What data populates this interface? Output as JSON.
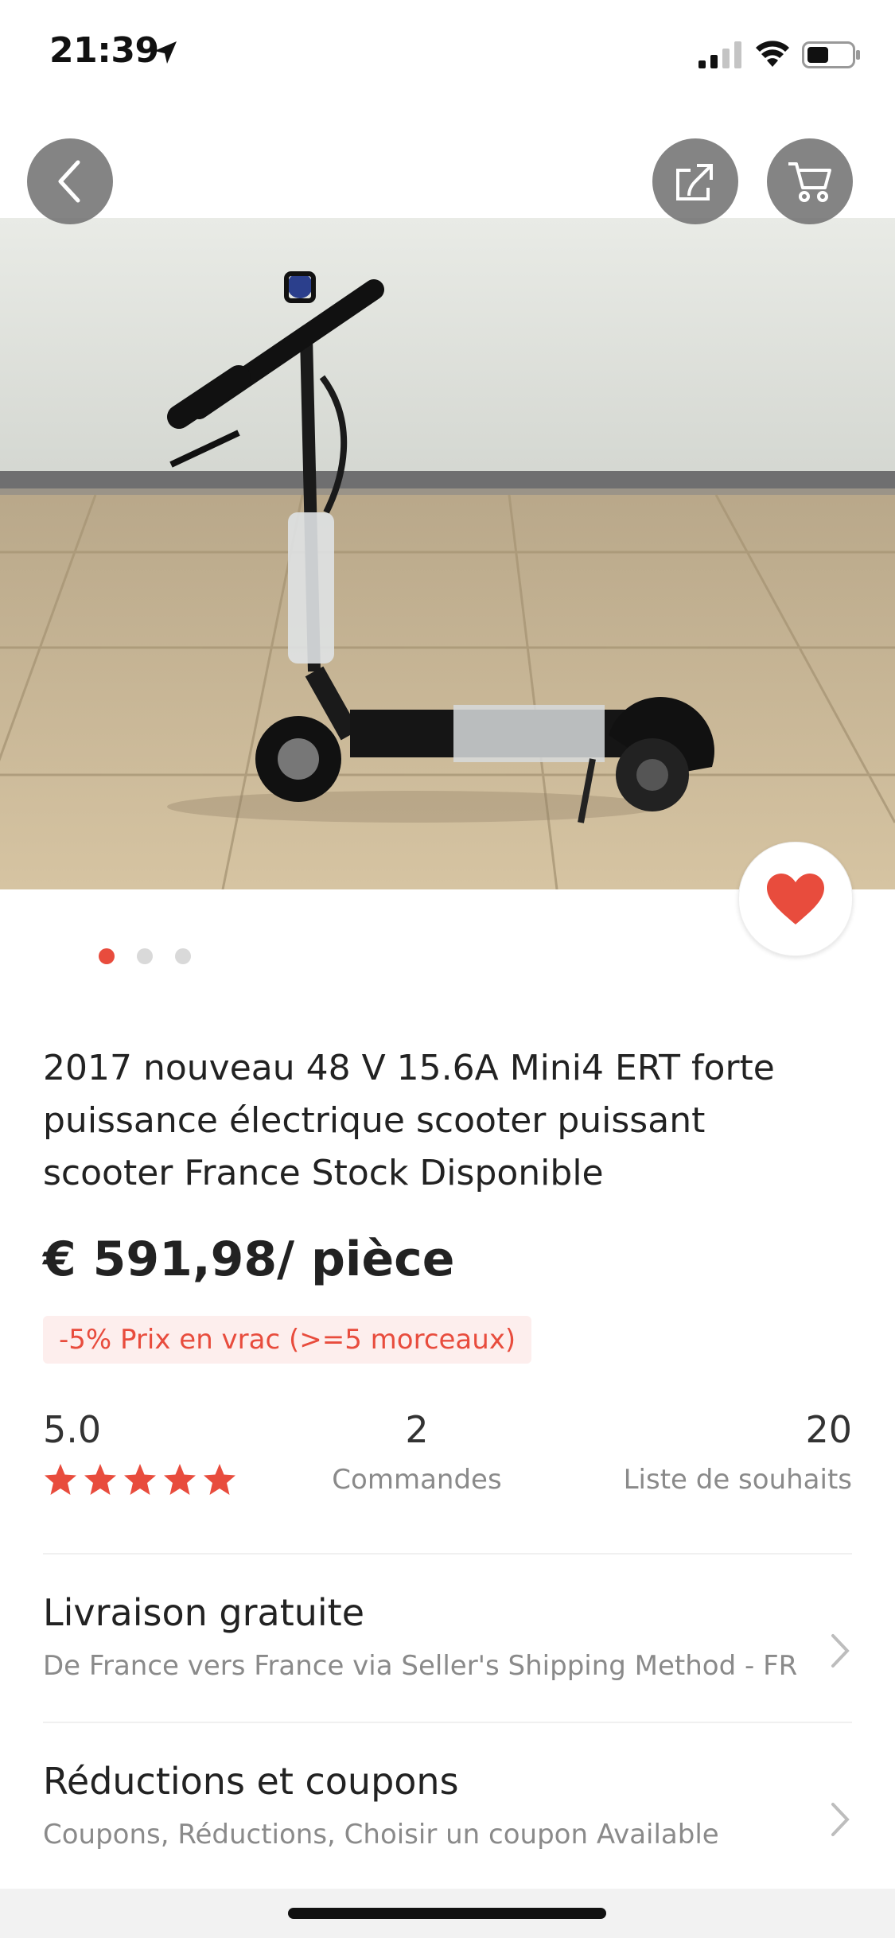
{
  "status_bar": {
    "time": "21:39"
  },
  "product": {
    "title": "2017 nouveau 48 V 15.6A Mini4 ERT forte puissance électrique scooter puissant scooter France Stock Disponible",
    "price": "€ 591,98/ pièce",
    "bulk_discount": "-5% Prix en vrac (>=5 morceaux)"
  },
  "carousel": {
    "total": 3,
    "active": 1
  },
  "stats": {
    "rating": "5.0",
    "stars": 5,
    "orders_count": "2",
    "orders_label": "Commandes",
    "wishlist_count": "20",
    "wishlist_label": "Liste de souhaits"
  },
  "shipping": {
    "title": "Livraison gratuite",
    "subtitle": "De France vers France via Seller's Shipping Method - FR"
  },
  "coupons": {
    "title": "Réductions et coupons",
    "subtitle": "Coupons, Réductions, Choisir un coupon Available"
  },
  "colors": {
    "accent": "#e84c3d"
  },
  "icons": [
    "location-arrow-icon",
    "signal-icon",
    "wifi-icon",
    "battery-icon",
    "back-icon",
    "share-icon",
    "cart-icon",
    "heart-icon",
    "star-icon",
    "chevron-right-icon"
  ]
}
